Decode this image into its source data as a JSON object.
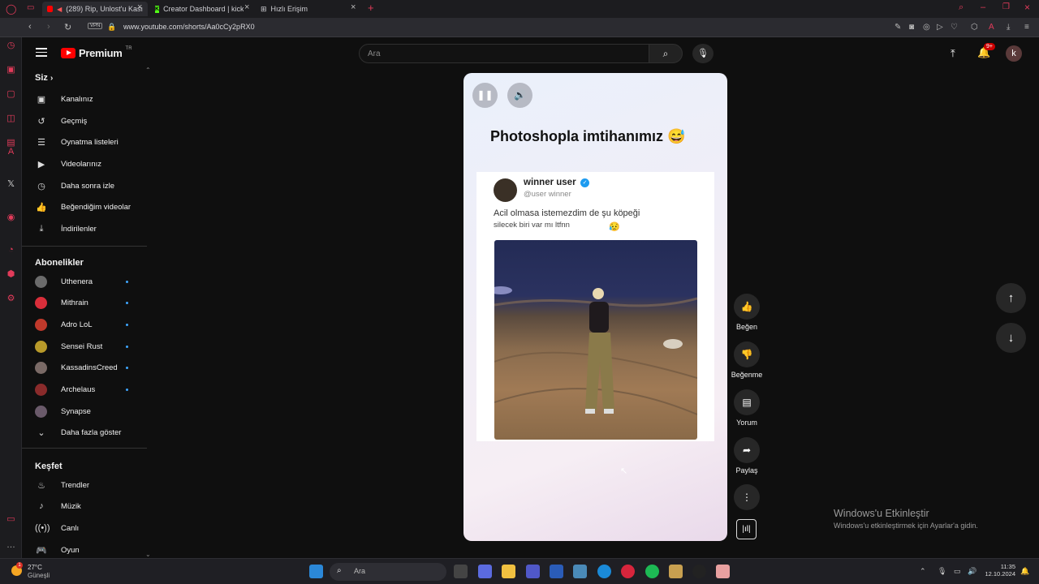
{
  "browser": {
    "tabs": [
      {
        "label": "(289) Rip, Unlost'u Kası",
        "icon": "youtube-icon",
        "active": true
      },
      {
        "label": "Creator Dashboard | kick",
        "icon": "kick-icon"
      },
      {
        "label": "Hızlı Erişim",
        "icon": "grid-icon"
      }
    ],
    "url": "www.youtube.com/shorts/Aa0cCy2pRX0",
    "vpn_label": "VPN"
  },
  "youtube": {
    "logo_text": "Premium",
    "logo_region": "TR",
    "search_placeholder": "Ara",
    "notification_count": "9+",
    "avatar_letter": "k"
  },
  "sidebar": {
    "you_heading": "Siz",
    "you_items": [
      {
        "label": "Kanalınız",
        "icon": "channel-icon"
      },
      {
        "label": "Geçmiş",
        "icon": "history-icon"
      },
      {
        "label": "Oynatma listeleri",
        "icon": "playlist-icon"
      },
      {
        "label": "Videolarınız",
        "icon": "video-icon"
      },
      {
        "label": "Daha sonra izle",
        "icon": "clock-icon"
      },
      {
        "label": "Beğendiğim videolar",
        "icon": "like-icon"
      },
      {
        "label": "İndirilenler",
        "icon": "download-icon"
      }
    ],
    "subs_heading": "Abonelikler",
    "subs": [
      {
        "label": "Uthenera",
        "color": "#6b6b6b",
        "live": true
      },
      {
        "label": "Mithrain",
        "color": "#d92e3a",
        "live": true
      },
      {
        "label": "Adro LoL",
        "color": "#c0392b",
        "live": true
      },
      {
        "label": "Sensei Rust",
        "color": "#b89a2a",
        "live": true
      },
      {
        "label": "KassadinsCreed",
        "color": "#7a6a66",
        "live": true
      },
      {
        "label": "Archelaus",
        "color": "#8a2b2b",
        "live": true
      },
      {
        "label": "Synapse",
        "color": "#6a5a6a",
        "live": false
      }
    ],
    "show_more": "Daha fazla göster",
    "explore_heading": "Keşfet",
    "explore_items": [
      {
        "label": "Trendler",
        "icon": "fire-icon"
      },
      {
        "label": "Müzik",
        "icon": "music-icon"
      },
      {
        "label": "Canlı",
        "icon": "live-icon"
      },
      {
        "label": "Oyun",
        "icon": "game-icon"
      }
    ]
  },
  "short": {
    "title": "Photoshopla imtihanımız 😅",
    "tweet": {
      "name": "winner user",
      "handle": "@user winner",
      "line1": "Acil olmasa istemezdim de şu köpeği",
      "line2": "silecek biri var mı ltfnn",
      "emoji": "😥"
    }
  },
  "actions": [
    {
      "label": "Beğen",
      "icon": "thumbs-up-icon"
    },
    {
      "label": "Beğenme",
      "icon": "thumbs-down-icon"
    },
    {
      "label": "Yorum",
      "icon": "comment-icon"
    },
    {
      "label": "Paylaş",
      "icon": "share-icon"
    }
  ],
  "watermark": {
    "line1": "Windows'u Etkinleştir",
    "line2": "Windows'u etkinleştirmek için Ayarlar'a gidin."
  },
  "taskbar": {
    "temp": "27°C",
    "condition": "Güneşli",
    "weather_badge": "1",
    "search_placeholder": "Ara",
    "time": "11:35",
    "date": "12.10.2024"
  }
}
